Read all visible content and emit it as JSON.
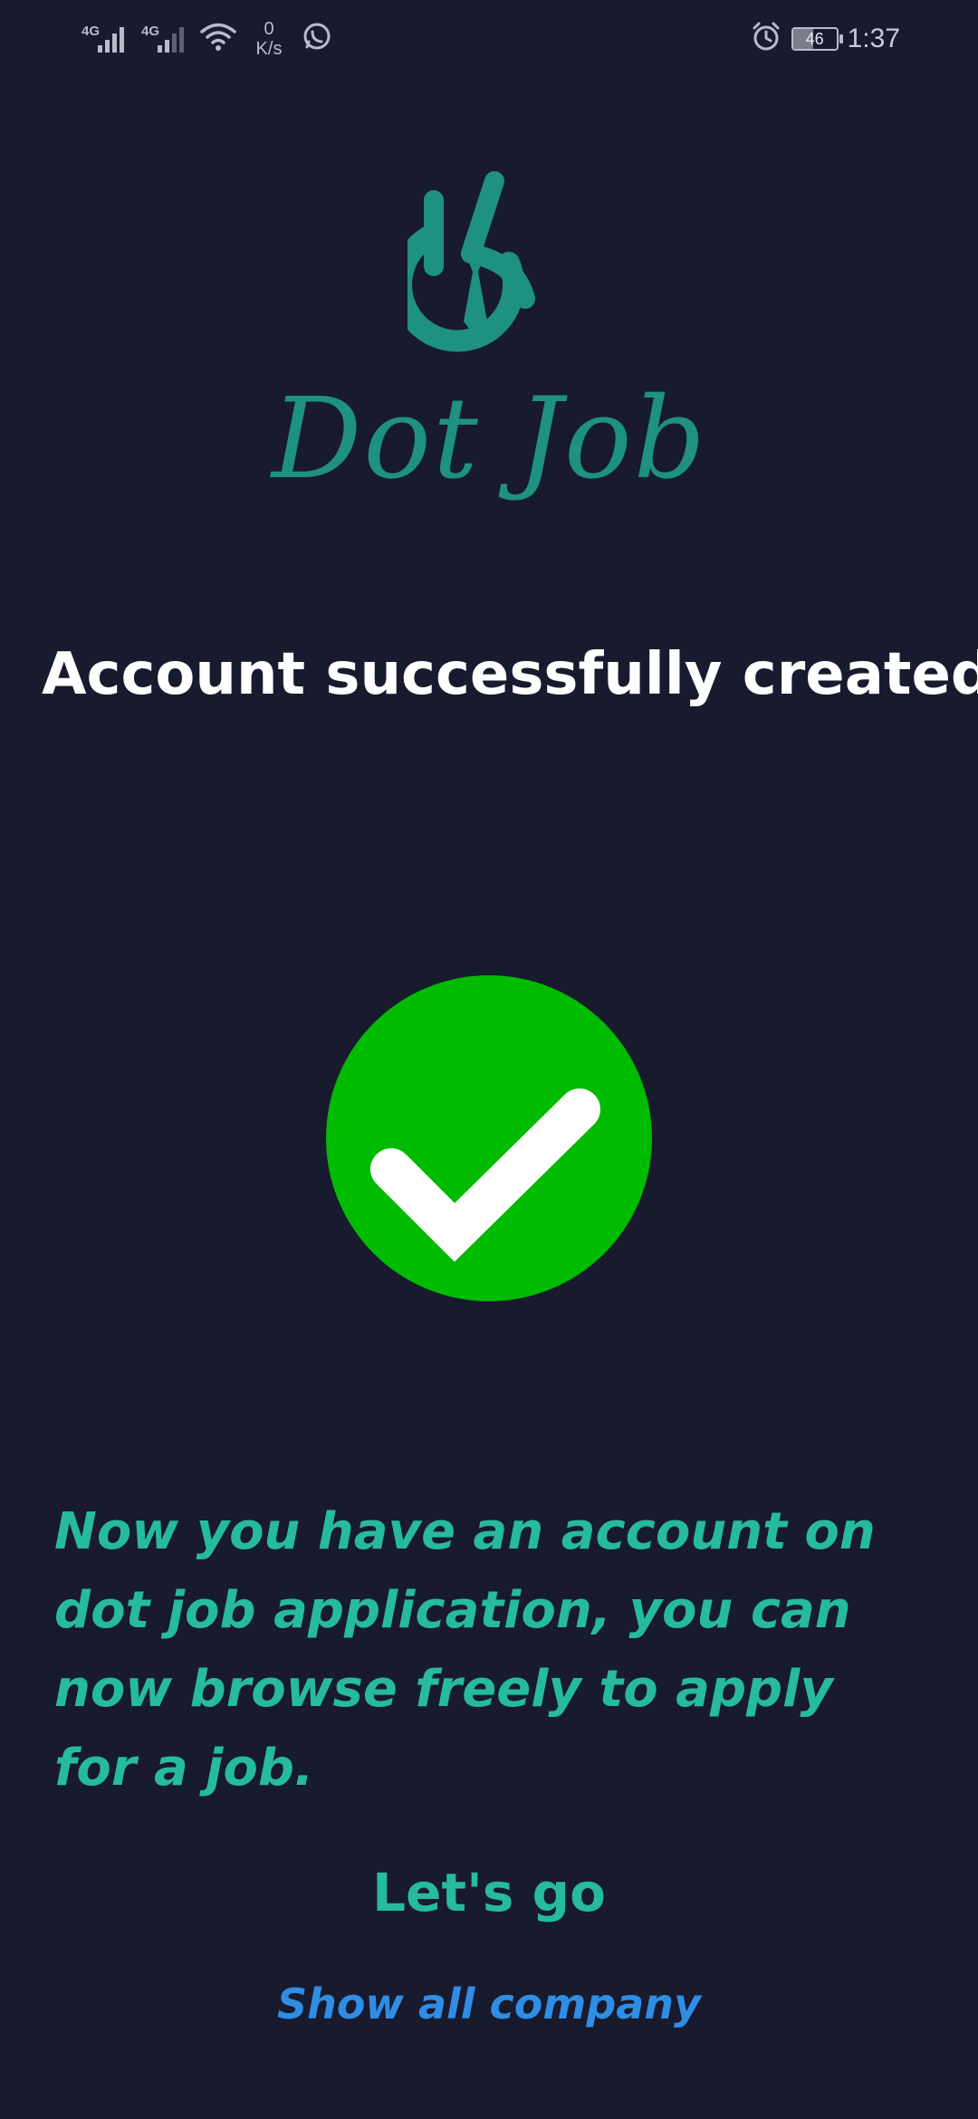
{
  "status_bar": {
    "net1_label": "4G",
    "net2_label": "4G",
    "speed_value": "0",
    "speed_unit": "K/s",
    "battery_level": "46",
    "time": "1:37",
    "icons": [
      "signal-icon",
      "signal-icon",
      "wifi-icon",
      "whatsapp-icon",
      "alarm-icon",
      "battery-icon"
    ]
  },
  "logo": {
    "text": "Dot Job",
    "color": "#1e9180"
  },
  "main": {
    "title": "Account successfully created",
    "status_icon": "check-circle-icon",
    "success_color": "#00bb00",
    "message": "Now you have an account on dot job application, you can now browse freely to apply for a job.",
    "primary_action": "Let's go",
    "secondary_action": "Show all company"
  },
  "colors": {
    "background": "#181a2e",
    "accent": "#26bb9b",
    "link": "#2f8de4"
  }
}
